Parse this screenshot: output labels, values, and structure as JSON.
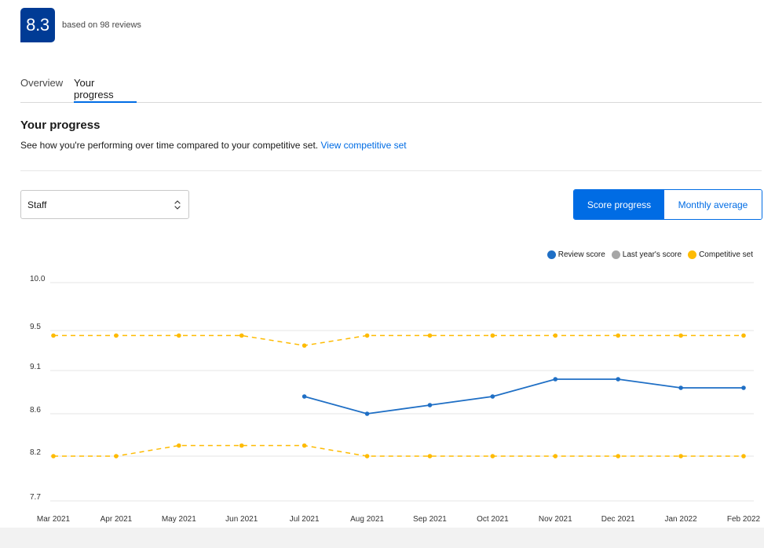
{
  "rating": {
    "score": "8.3",
    "review_text": "based on 98 reviews"
  },
  "tabs": [
    {
      "label": "Overview",
      "active": false
    },
    {
      "label": "Your progress",
      "active": true
    }
  ],
  "section": {
    "title": "Your progress",
    "description": "See how you're performing over time compared to your competitive set.",
    "link_label": "View competitive set"
  },
  "filter": {
    "selected": "Staff"
  },
  "toggle": {
    "score_progress": "Score progress",
    "monthly_average": "Monthly average",
    "active": "score_progress"
  },
  "colors": {
    "accent": "#006ce4",
    "badge": "#003b95",
    "review_score": "#1f6fc5",
    "last_year": "#a6a6a6",
    "competitive": "#febb02"
  },
  "chart_data": {
    "type": "line",
    "categories": [
      "Mar 2021",
      "Apr 2021",
      "May 2021",
      "Jun 2021",
      "Jul 2021",
      "Aug 2021",
      "Sep 2021",
      "Oct 2021",
      "Nov 2021",
      "Dec 2021",
      "Jan 2022",
      "Feb 2022"
    ],
    "y_ticks": [
      "10.0",
      "9.5",
      "9.1",
      "8.6",
      "8.2",
      "7.7"
    ],
    "y_tick_values": [
      10.0,
      9.5,
      9.1,
      8.6,
      8.2,
      7.7
    ],
    "ylim": [
      7.7,
      10.0
    ],
    "grid": true,
    "legend_position": "top-right",
    "series": [
      {
        "name": "Review score",
        "style": "solid",
        "color": "#1f6fc5",
        "values": [
          null,
          null,
          null,
          null,
          8.8,
          8.6,
          8.7,
          8.8,
          9.0,
          9.0,
          8.9,
          8.9
        ]
      },
      {
        "name": "Last year's score",
        "style": "solid",
        "color": "#a6a6a6",
        "values": [
          null,
          null,
          null,
          null,
          null,
          null,
          null,
          null,
          null,
          null,
          null,
          null
        ]
      },
      {
        "name": "Competitive set",
        "style": "dashed",
        "color": "#febb02",
        "values": [
          9.45,
          9.45,
          9.45,
          9.45,
          9.35,
          9.45,
          9.45,
          9.45,
          9.45,
          9.45,
          9.45,
          9.45
        ]
      },
      {
        "name": "Competitive set",
        "style": "dashed",
        "color": "#febb02",
        "values": [
          8.2,
          8.2,
          8.3,
          8.3,
          8.3,
          8.2,
          8.2,
          8.2,
          8.2,
          8.2,
          8.2,
          8.2
        ]
      }
    ]
  }
}
